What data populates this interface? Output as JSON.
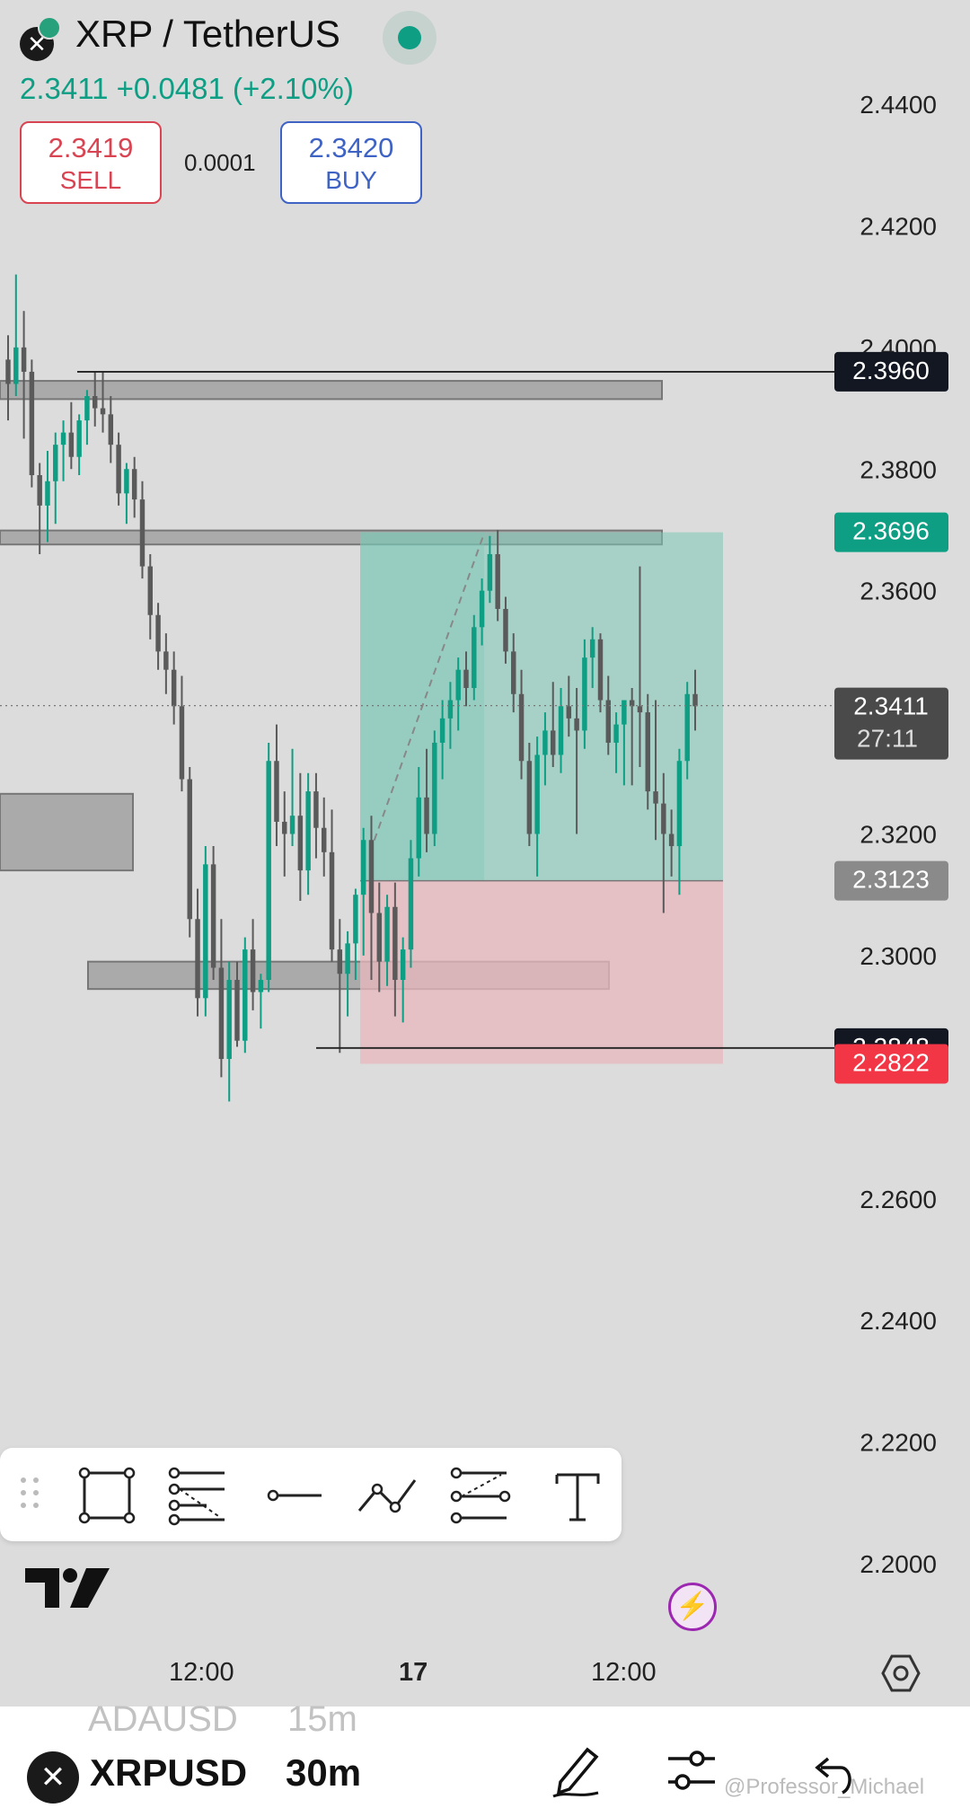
{
  "header": {
    "title": "XRP / TetherUS",
    "close_glyph": "✕",
    "price_line": "2.3411  +0.0481 (+2.10%)",
    "sell_price": "2.3419",
    "sell_label": "SELL",
    "spread": "0.0001",
    "buy_price": "2.3420",
    "buy_label": "BUY"
  },
  "colors": {
    "up": "#0d9e84",
    "down": "#5a5a5a",
    "sell": "#d94452",
    "buy": "#3f63c4",
    "profit_zone": "#7cc7b5",
    "loss_zone": "#e8b7bd"
  },
  "chart_data": {
    "type": "candlestick",
    "y_range": [
      2.19,
      2.455
    ],
    "y_ticks": [
      "2.4400",
      "2.4200",
      "2.4000",
      "2.3800",
      "2.3600",
      "2.3200",
      "2.3000",
      "2.2600",
      "2.2400",
      "2.2200",
      "2.2000"
    ],
    "x_labels": [
      "12:00",
      "17",
      "12:00"
    ],
    "price_tags": [
      {
        "label": "2.3960",
        "value": 2.396,
        "style": "dark"
      },
      {
        "label": "2.3696",
        "value": 2.3696,
        "style": "green"
      },
      {
        "label": "2.3411",
        "sub": "27:11",
        "value": 2.3411,
        "style": "grey-dark"
      },
      {
        "label": "2.3123",
        "value": 2.3123,
        "style": "grey"
      },
      {
        "label": "2.2848",
        "value": 2.2848,
        "style": "dark"
      },
      {
        "label": "2.2822",
        "value": 2.2822,
        "style": "red"
      }
    ],
    "position": {
      "entry": 2.3123,
      "target": 2.3696,
      "stop": 2.2822
    },
    "zones": [
      {
        "top": 2.3945,
        "bottom": 2.3915
      },
      {
        "top": 2.3699,
        "bottom": 2.3676
      },
      {
        "top": 2.3266,
        "bottom": 2.314
      },
      {
        "top": 2.299,
        "bottom": 2.2945
      }
    ],
    "hlines": [
      2.396,
      2.2848
    ],
    "candles": [
      [
        2.398,
        2.402,
        2.388,
        2.394
      ],
      [
        2.394,
        2.412,
        2.392,
        2.4
      ],
      [
        2.4,
        2.406,
        2.385,
        2.396
      ],
      [
        2.396,
        2.398,
        2.377,
        2.379
      ],
      [
        2.379,
        2.381,
        2.366,
        2.374
      ],
      [
        2.374,
        2.383,
        2.368,
        2.378
      ],
      [
        2.378,
        2.386,
        2.371,
        2.384
      ],
      [
        2.384,
        2.388,
        2.378,
        2.386
      ],
      [
        2.386,
        2.391,
        2.38,
        2.382
      ],
      [
        2.382,
        2.389,
        2.379,
        2.388
      ],
      [
        2.388,
        2.393,
        2.384,
        2.392
      ],
      [
        2.392,
        2.396,
        2.387,
        2.39
      ],
      [
        2.39,
        2.396,
        2.386,
        2.389
      ],
      [
        2.389,
        2.392,
        2.381,
        2.384
      ],
      [
        2.384,
        2.386,
        2.374,
        2.376
      ],
      [
        2.376,
        2.381,
        2.371,
        2.38
      ],
      [
        2.38,
        2.382,
        2.372,
        2.375
      ],
      [
        2.375,
        2.378,
        2.362,
        2.364
      ],
      [
        2.364,
        2.366,
        2.352,
        2.356
      ],
      [
        2.356,
        2.358,
        2.347,
        2.35
      ],
      [
        2.35,
        2.353,
        2.343,
        2.347
      ],
      [
        2.347,
        2.35,
        2.338,
        2.341
      ],
      [
        2.341,
        2.346,
        2.327,
        2.329
      ],
      [
        2.329,
        2.331,
        2.303,
        2.306
      ],
      [
        2.306,
        2.311,
        2.29,
        2.293
      ],
      [
        2.293,
        2.318,
        2.29,
        2.315
      ],
      [
        2.315,
        2.318,
        2.296,
        2.298
      ],
      [
        2.298,
        2.306,
        2.28,
        2.283
      ],
      [
        2.283,
        2.299,
        2.276,
        2.296
      ],
      [
        2.296,
        2.299,
        2.285,
        2.286
      ],
      [
        2.286,
        2.303,
        2.284,
        2.301
      ],
      [
        2.301,
        2.306,
        2.291,
        2.294
      ],
      [
        2.294,
        2.297,
        2.288,
        2.296
      ],
      [
        2.296,
        2.335,
        2.294,
        2.332
      ],
      [
        2.332,
        2.338,
        2.318,
        2.322
      ],
      [
        2.322,
        2.327,
        2.313,
        2.32
      ],
      [
        2.32,
        2.334,
        2.318,
        2.323
      ],
      [
        2.323,
        2.33,
        2.309,
        2.314
      ],
      [
        2.314,
        2.33,
        2.31,
        2.327
      ],
      [
        2.327,
        2.33,
        2.316,
        2.321
      ],
      [
        2.321,
        2.326,
        2.313,
        2.317
      ],
      [
        2.317,
        2.324,
        2.299,
        2.301
      ],
      [
        2.301,
        2.306,
        2.284,
        2.297
      ],
      [
        2.297,
        2.304,
        2.29,
        2.302
      ],
      [
        2.302,
        2.311,
        2.296,
        2.31
      ],
      [
        2.31,
        2.321,
        2.3,
        2.319
      ],
      [
        2.319,
        2.323,
        2.296,
        2.307
      ],
      [
        2.307,
        2.312,
        2.294,
        2.299
      ],
      [
        2.299,
        2.31,
        2.295,
        2.308
      ],
      [
        2.308,
        2.312,
        2.29,
        2.296
      ],
      [
        2.296,
        2.303,
        2.289,
        2.301
      ],
      [
        2.301,
        2.319,
        2.298,
        2.316
      ],
      [
        2.316,
        2.331,
        2.313,
        2.326
      ],
      [
        2.326,
        2.334,
        2.317,
        2.32
      ],
      [
        2.32,
        2.337,
        2.318,
        2.335
      ],
      [
        2.335,
        2.342,
        2.329,
        2.339
      ],
      [
        2.339,
        2.345,
        2.334,
        2.342
      ],
      [
        2.342,
        2.349,
        2.337,
        2.347
      ],
      [
        2.347,
        2.35,
        2.341,
        2.344
      ],
      [
        2.344,
        2.356,
        2.342,
        2.354
      ],
      [
        2.354,
        2.362,
        2.351,
        2.36
      ],
      [
        2.36,
        2.369,
        2.358,
        2.366
      ],
      [
        2.366,
        2.37,
        2.355,
        2.357
      ],
      [
        2.357,
        2.359,
        2.348,
        2.35
      ],
      [
        2.35,
        2.353,
        2.34,
        2.343
      ],
      [
        2.343,
        2.347,
        2.329,
        2.332
      ],
      [
        2.332,
        2.335,
        2.318,
        2.32
      ],
      [
        2.32,
        2.336,
        2.313,
        2.333
      ],
      [
        2.333,
        2.34,
        2.328,
        2.337
      ],
      [
        2.337,
        2.345,
        2.331,
        2.333
      ],
      [
        2.333,
        2.344,
        2.33,
        2.341
      ],
      [
        2.341,
        2.346,
        2.336,
        2.339
      ],
      [
        2.339,
        2.344,
        2.32,
        2.337
      ],
      [
        2.337,
        2.352,
        2.334,
        2.349
      ],
      [
        2.349,
        2.354,
        2.344,
        2.352
      ],
      [
        2.352,
        2.353,
        2.34,
        2.342
      ],
      [
        2.342,
        2.346,
        2.333,
        2.335
      ],
      [
        2.335,
        2.34,
        2.33,
        2.338
      ],
      [
        2.338,
        2.341,
        2.328,
        2.342
      ],
      [
        2.342,
        2.344,
        2.328,
        2.341
      ],
      [
        2.341,
        2.364,
        2.331,
        2.34
      ],
      [
        2.34,
        2.343,
        2.324,
        2.327
      ],
      [
        2.327,
        2.342,
        2.319,
        2.325
      ],
      [
        2.325,
        2.33,
        2.307,
        2.32
      ],
      [
        2.32,
        2.324,
        2.313,
        2.318
      ],
      [
        2.318,
        2.334,
        2.31,
        2.332
      ],
      [
        2.332,
        2.345,
        2.329,
        2.343
      ],
      [
        2.343,
        2.347,
        2.337,
        2.341
      ]
    ]
  },
  "drawing_toolbar": {
    "tools": [
      "rectangle-icon",
      "fib-retracement-icon",
      "horizontal-line-icon",
      "path-icon",
      "parallel-channel-icon",
      "text-tool-icon"
    ]
  },
  "bottom_bar": {
    "ghost_symbol": "ADAUSD",
    "ghost_timeframe": "15m",
    "symbol": "XRPUSD",
    "symbol_icon_glyph": "✕",
    "timeframe": "30m",
    "watermark": "@Professor_Michael"
  }
}
